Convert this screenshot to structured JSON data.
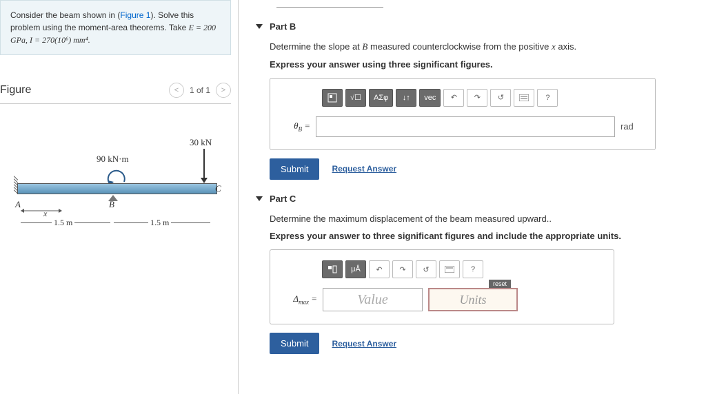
{
  "problem": {
    "text_before_link": "Consider the beam shown in (",
    "link_text": "Figure 1",
    "text_after_link": "). Solve this problem using the moment-area theorems. Take ",
    "formula": "E = 200 GPa, I = 270(10⁶) mm⁴."
  },
  "figure": {
    "title": "Figure",
    "nav_text": "1 of 1",
    "moment_label": "90 kN·m",
    "force_label": "30 kN",
    "pt_A": "A",
    "pt_B": "B",
    "pt_C": "C",
    "x_label": "x",
    "dim1": "1.5 m",
    "dim2": "1.5 m"
  },
  "partB": {
    "title": "Part B",
    "prompt_before": "Determine the slope at ",
    "prompt_var": "B",
    "prompt_after": " measured counterclockwise from the positive ",
    "prompt_var2": "x",
    "prompt_end": " axis.",
    "instruction": "Express your answer using three significant figures.",
    "var_label": "θ",
    "var_sub": "B",
    "equals": " =",
    "unit": "rad",
    "toolbar": {
      "greek": "ΑΣφ",
      "vec": "vec",
      "help": "?"
    },
    "submit": "Submit",
    "request": "Request Answer"
  },
  "partC": {
    "title": "Part C",
    "prompt": "Determine the maximum displacement of the beam measured upward..",
    "instruction": "Express your answer to three significant figures and include the appropriate units.",
    "var_label": "Δ",
    "var_sub": "max",
    "equals": " =",
    "value_placeholder": "Value",
    "units_placeholder": "Units",
    "reset": "reset",
    "toolbar": {
      "ua": "μÅ",
      "help": "?"
    },
    "submit": "Submit",
    "request": "Request Answer"
  }
}
